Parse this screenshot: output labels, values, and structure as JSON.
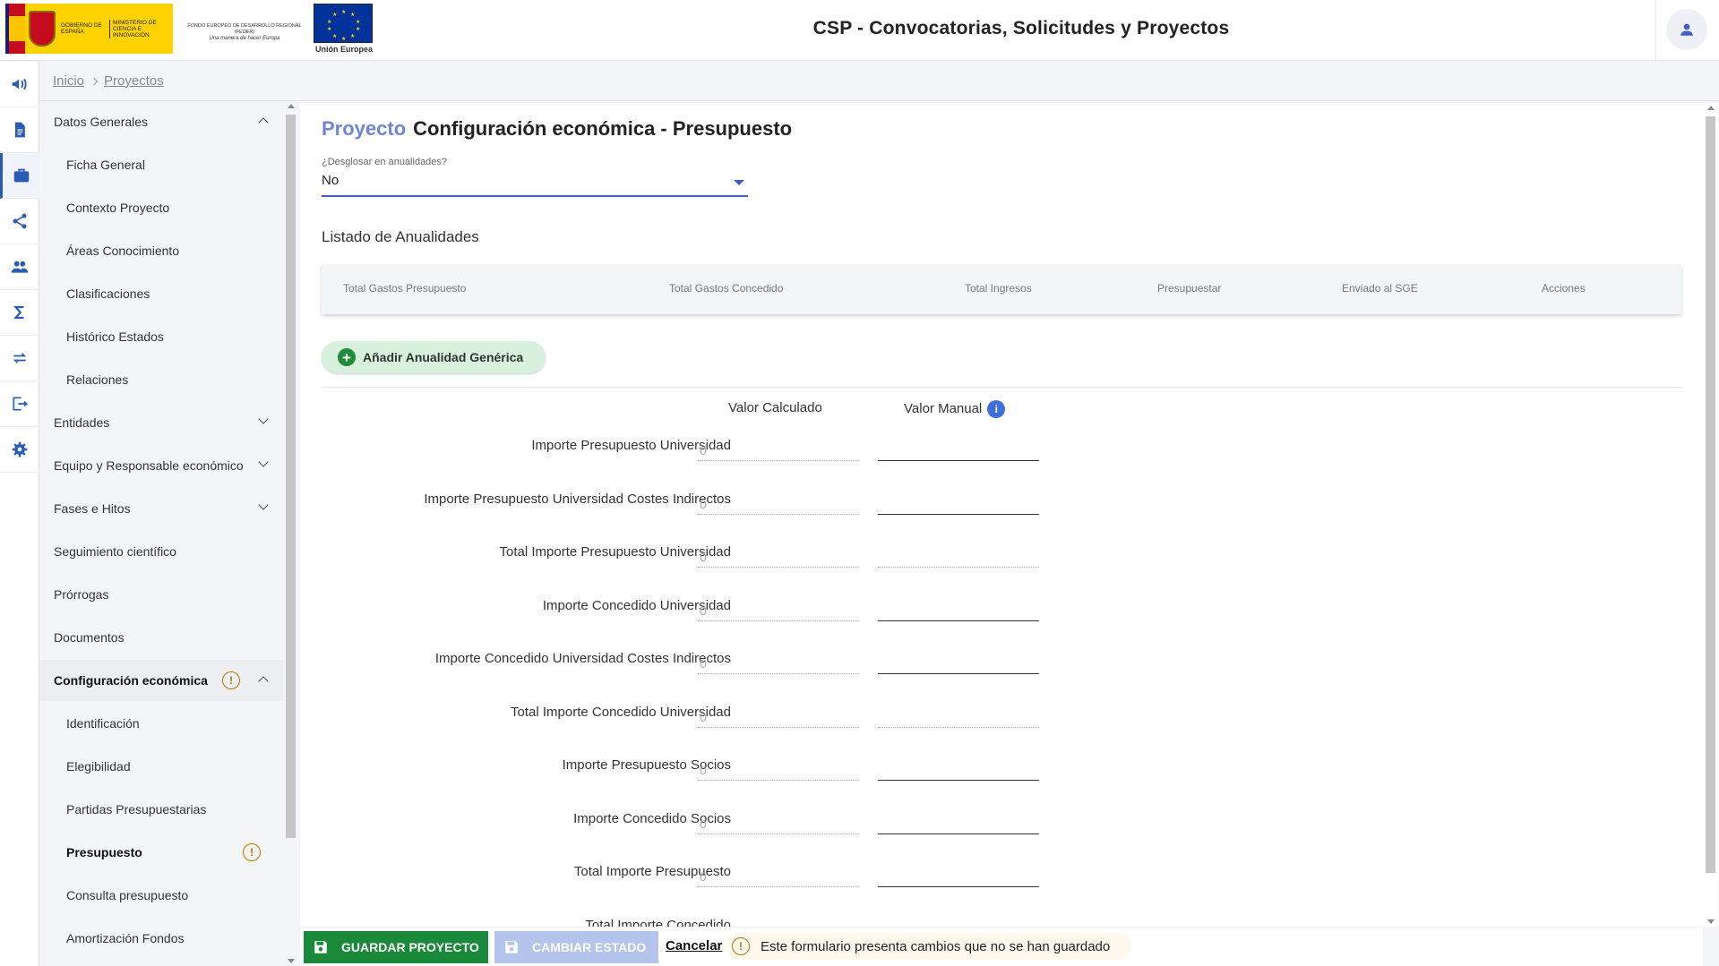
{
  "header": {
    "logo_gob_text": "GOBIERNO DE ESPAÑA",
    "logo_min_text": "MINISTERIO DE CIENCIA E INNOVACIÓN",
    "logo_feder_text": "FONDO EUROPEO DE DESARROLLO REGIONAL (FEDER)",
    "logo_feder_motto": "Una manera de hacer Europa",
    "logo_eu_text": "Unión Europea",
    "title": "CSP - Convocatorias, Solicitudes y Proyectos"
  },
  "rail": [
    {
      "icon": "megaphone-icon"
    },
    {
      "icon": "document-icon"
    },
    {
      "icon": "briefcase-icon",
      "active": true
    },
    {
      "icon": "share-icon"
    },
    {
      "icon": "people-icon"
    },
    {
      "icon": "sigma-icon"
    },
    {
      "icon": "swap-arrows-icon"
    },
    {
      "icon": "logout-icon"
    },
    {
      "icon": "gear-icon"
    }
  ],
  "breadcrumb": {
    "home": "Inicio",
    "current": "Proyectos"
  },
  "sidenav": {
    "datos_generales": "Datos Generales",
    "ficha_general": "Ficha General",
    "contexto_proyecto": "Contexto Proyecto",
    "areas_conocimiento": "Áreas Conocimiento",
    "clasificaciones": "Clasificaciones",
    "historico_estados": "Histórico Estados",
    "relaciones": "Relaciones",
    "entidades": "Entidades",
    "equipo": "Equipo y Responsable económico",
    "fases": "Fases e Hitos",
    "seguimiento": "Seguimiento científico",
    "prorrogas": "Prórrogas",
    "documentos": "Documentos",
    "config_economica": "Configuración económica",
    "identificacion": "Identificación",
    "elegibilidad": "Elegibilidad",
    "partidas": "Partidas Presupuestarias",
    "presupuesto": "Presupuesto",
    "consulta_presupuesto": "Consulta presupuesto",
    "amortizacion": "Amortización Fondos",
    "warn_glyph": "!"
  },
  "main": {
    "title_prefix": "Proyecto",
    "title": "Configuración económica - Presupuesto",
    "desglosar": {
      "label": "¿Desglosar en anualidades?",
      "value": "No"
    },
    "listado_title": "Listado de Anualidades",
    "table_headers": [
      "Total Gastos Presupuesto",
      "Total Gastos Concedido",
      "Total Ingresos",
      "Presupuestar",
      "Enviado al SGE",
      "Acciones"
    ],
    "add_button": "Añadir Anualidad Genérica",
    "col_calculado": "Valor Calculado",
    "col_manual": "Valor Manual",
    "info_glyph": "i",
    "rows": [
      {
        "label": "Importe Presupuesto Universidad",
        "calc": "0",
        "manual_enabled": true
      },
      {
        "label": "Importe Presupuesto Universidad Costes Indirectos",
        "calc": "0",
        "manual_enabled": true
      },
      {
        "label": "Total Importe Presupuesto Universidad",
        "calc": "0",
        "manual_enabled": false
      },
      {
        "label": "Importe Concedido Universidad",
        "calc": "0",
        "manual_enabled": true
      },
      {
        "label": "Importe Concedido Universidad Costes Indirectos",
        "calc": "0",
        "manual_enabled": true
      },
      {
        "label": "Total Importe Concedido Universidad",
        "calc": "0",
        "manual_enabled": false
      },
      {
        "label": "Importe Presupuesto Socios",
        "calc": "0",
        "manual_enabled": true
      },
      {
        "label": "Importe Concedido Socios",
        "calc": "0",
        "manual_enabled": true
      },
      {
        "label": "Total Importe Presupuesto",
        "calc": "0",
        "manual_enabled": true
      },
      {
        "label": "Total Importe Concedido",
        "calc": "",
        "manual_enabled": false
      }
    ]
  },
  "footer": {
    "save": "GUARDAR PROYECTO",
    "change_state": "CAMBIAR ESTADO",
    "cancel": "Cancelar",
    "unsaved": "Este formulario presenta cambios que no se han guardado"
  },
  "colors": {
    "accent": "#3f5fc8",
    "title_prefix": "#6f86d6",
    "save_button": "#1a8a3a",
    "disabled_button": "#b4c4ec",
    "warning": "#b07800",
    "add_button_bg": "#d7f1dc"
  }
}
